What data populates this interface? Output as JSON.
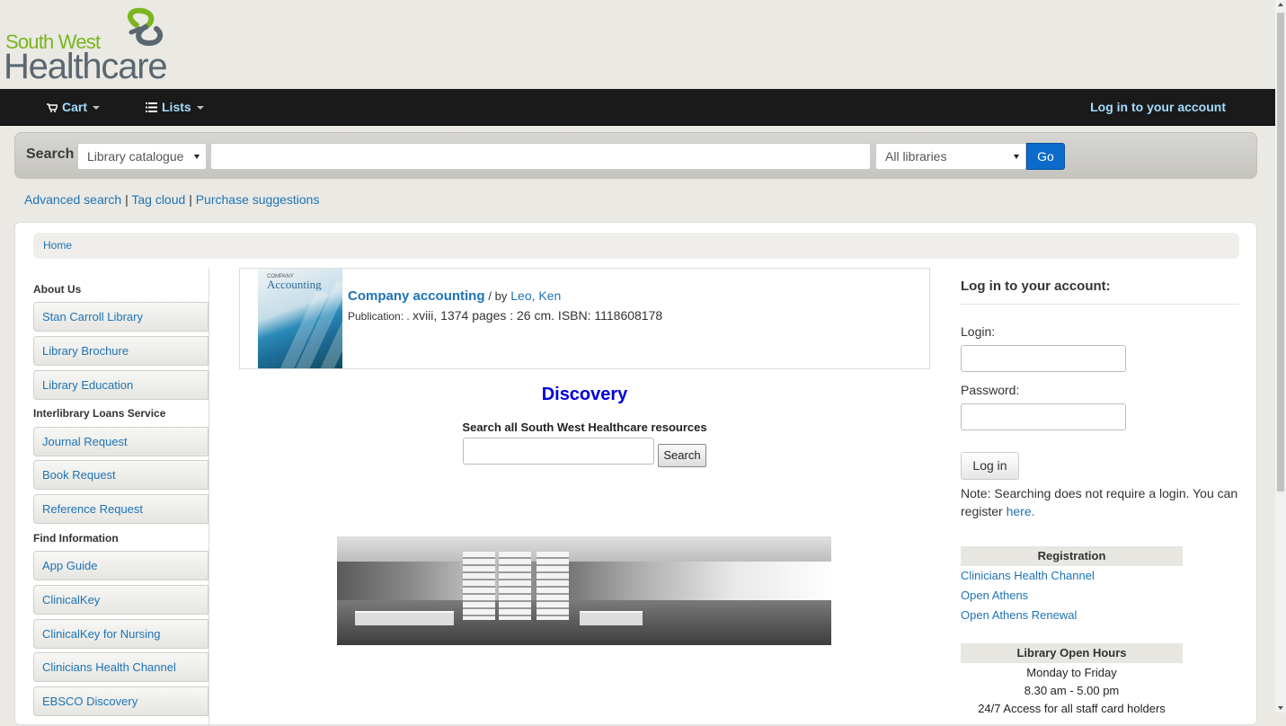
{
  "brand": {
    "line1": "South West",
    "line2": "Healthcare"
  },
  "nav": {
    "cart": "Cart",
    "lists": "Lists",
    "login": "Log in to your account"
  },
  "search": {
    "label": "Search",
    "scope": "Library catalogue",
    "query": "",
    "libraries": "All libraries",
    "go": "Go"
  },
  "sublinks": {
    "advanced": "Advanced search",
    "tagcloud": "Tag cloud",
    "suggestions": "Purchase suggestions",
    "sep": "|"
  },
  "breadcrumb": {
    "home": "Home"
  },
  "leftnav": {
    "about": "About Us",
    "about_items": [
      "Stan Carroll Library",
      "Library Brochure",
      "Library Education"
    ],
    "ill": "Interlibrary Loans Service",
    "ill_items": [
      "Journal Request",
      "Book Request",
      "Reference Request"
    ],
    "find": "Find Information",
    "find_items": [
      "App Guide",
      "ClinicalKey",
      "ClinicalKey for Nursing",
      "Clinicians Health Channel",
      "EBSCO Discovery"
    ]
  },
  "book": {
    "cover_small": "COMPANY",
    "cover_title": "Accounting",
    "title": "Company accounting",
    "by": "/ by",
    "author": "Leo, Ken",
    "pub_label": "Publication: .",
    "pub_details": "xviii, 1374 pages : 26 cm. ISBN: 1118608178"
  },
  "discovery": {
    "heading": "Discovery",
    "label": "Search all South West Healthcare resources",
    "button": "Search"
  },
  "login": {
    "title": "Log in to your account:",
    "login_label": "Login:",
    "password_label": "Password:",
    "button": "Log in",
    "note": "Note: Searching does not require a login.  You can register",
    "here": "here."
  },
  "registration": {
    "heading": "Registration",
    "links": [
      "Clinicians Health Channel",
      "Open Athens",
      "Open Athens Renewal"
    ]
  },
  "hours": {
    "heading": "Library Open Hours",
    "days": "Monday to Friday",
    "time": "8.30 am - 5.00 pm",
    "access": "24/7 Access for all staff card holders"
  },
  "colors": {
    "brand_green": "#7ab51d",
    "brand_grey": "#5b6770",
    "link": "#1e73b4",
    "navbar": "#1a1a1a",
    "go_button": "#0b6bca"
  }
}
